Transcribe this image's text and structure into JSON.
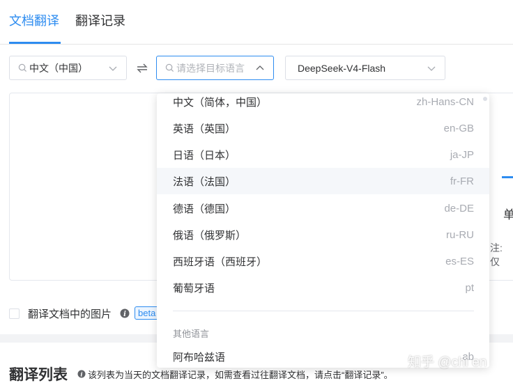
{
  "tabs": [
    {
      "label": "文档翻译",
      "active": true
    },
    {
      "label": "翻译记录",
      "active": false
    }
  ],
  "source_select": {
    "value": "中文（中国）"
  },
  "target_select": {
    "placeholder": "请选择目标语言"
  },
  "model_select": {
    "value": "DeepSeek-V4-Flash"
  },
  "panel": {
    "cut_text_1": "单",
    "cut_text_2": "注: 仅"
  },
  "options": {
    "translate_images_label": "翻译文档中的图片",
    "beta_badge": "beta"
  },
  "list": {
    "title": "翻译列表",
    "note": "该列表为当天的文档翻译记录，如需查看过往翻译文档，请点击“翻译记录”。"
  },
  "dropdown": {
    "languages": [
      {
        "name": "中文（简体，中国）",
        "code": "zh-Hans-CN"
      },
      {
        "name": "英语（英国）",
        "code": "en-GB"
      },
      {
        "name": "日语（日本）",
        "code": "ja-JP"
      },
      {
        "name": "法语（法国）",
        "code": "fr-FR",
        "hovered": true
      },
      {
        "name": "德语（德国）",
        "code": "de-DE"
      },
      {
        "name": "俄语（俄罗斯）",
        "code": "ru-RU"
      },
      {
        "name": "西班牙语（西班牙）",
        "code": "es-ES"
      },
      {
        "name": "葡萄牙语",
        "code": "pt"
      }
    ],
    "group_label": "其他语言",
    "other_languages": [
      {
        "name": "阿布哈兹语",
        "code": "ab"
      }
    ]
  },
  "watermark": "知乎 @chi en",
  "colors": {
    "accent": "#2d8cf0",
    "hover_bg": "#f5f7fa",
    "text": "#303133",
    "muted": "#a8abb2"
  },
  "icons": [
    "search-icon",
    "chevron-down-icon",
    "chevron-up-icon",
    "swap-icon",
    "info-icon"
  ]
}
